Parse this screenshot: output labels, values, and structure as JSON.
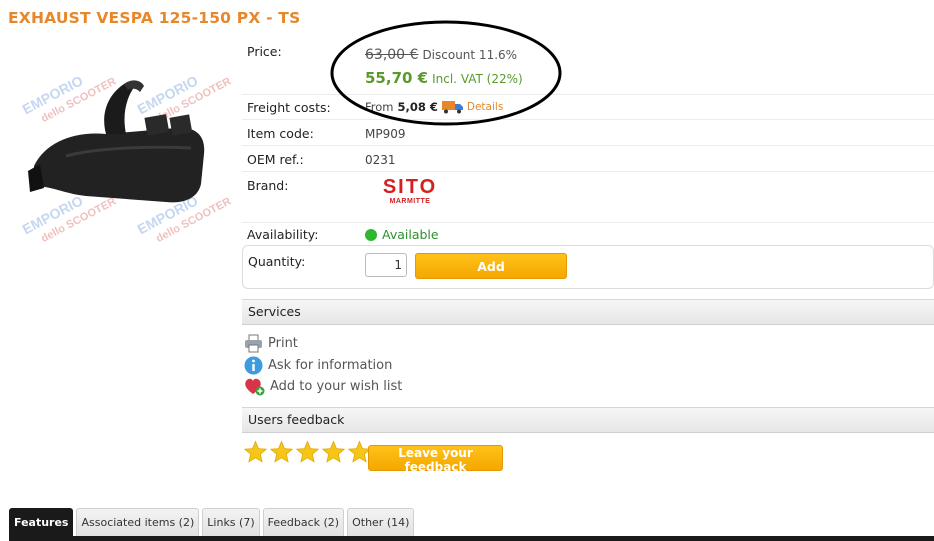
{
  "colors": {
    "title": "#e8872a",
    "price_green": "#5a9a2c",
    "button": "#f5b000",
    "available": "#2eb82e"
  },
  "product": {
    "title": "EXHAUST VESPA 125-150 PX - TS",
    "watermark_line1": "EMPORIO",
    "watermark_line2": "dello SCOOTER"
  },
  "info": {
    "price_label": "Price:",
    "old_price": "63,00 €",
    "discount": "Discount 11.6%",
    "new_price": "55,70 €",
    "vat": "Incl. VAT (22%)",
    "freight_label": "Freight costs:",
    "freight_prefix": "From",
    "freight_value": "5,08 €",
    "details_link": "Details",
    "code_label": "Item code:",
    "code_value": "MP909",
    "oem_label": "OEM ref.:",
    "oem_value": "0231",
    "brand_label": "Brand:",
    "brand_name": "SITO",
    "brand_sub": "MARMITTE",
    "availability_label": "Availability:",
    "availability_value": "Available"
  },
  "cart": {
    "quantity_label": "Quantity:",
    "quantity_value": "1",
    "add_label": "Add"
  },
  "services": {
    "header": "Services",
    "items": [
      {
        "label": "Print",
        "icon": "printer-icon"
      },
      {
        "label": "Ask for information",
        "icon": "info-icon"
      },
      {
        "label": "Add to your wish list",
        "icon": "heart-plus-icon"
      }
    ]
  },
  "feedback": {
    "header": "Users feedback",
    "stars": 5,
    "button": "Leave your feedback"
  },
  "tabs": [
    {
      "label": "Features",
      "active": true
    },
    {
      "label": "Associated items (2)",
      "active": false
    },
    {
      "label": "Links (7)",
      "active": false
    },
    {
      "label": "Feedback (2)",
      "active": false
    },
    {
      "label": "Other (14)",
      "active": false
    }
  ]
}
